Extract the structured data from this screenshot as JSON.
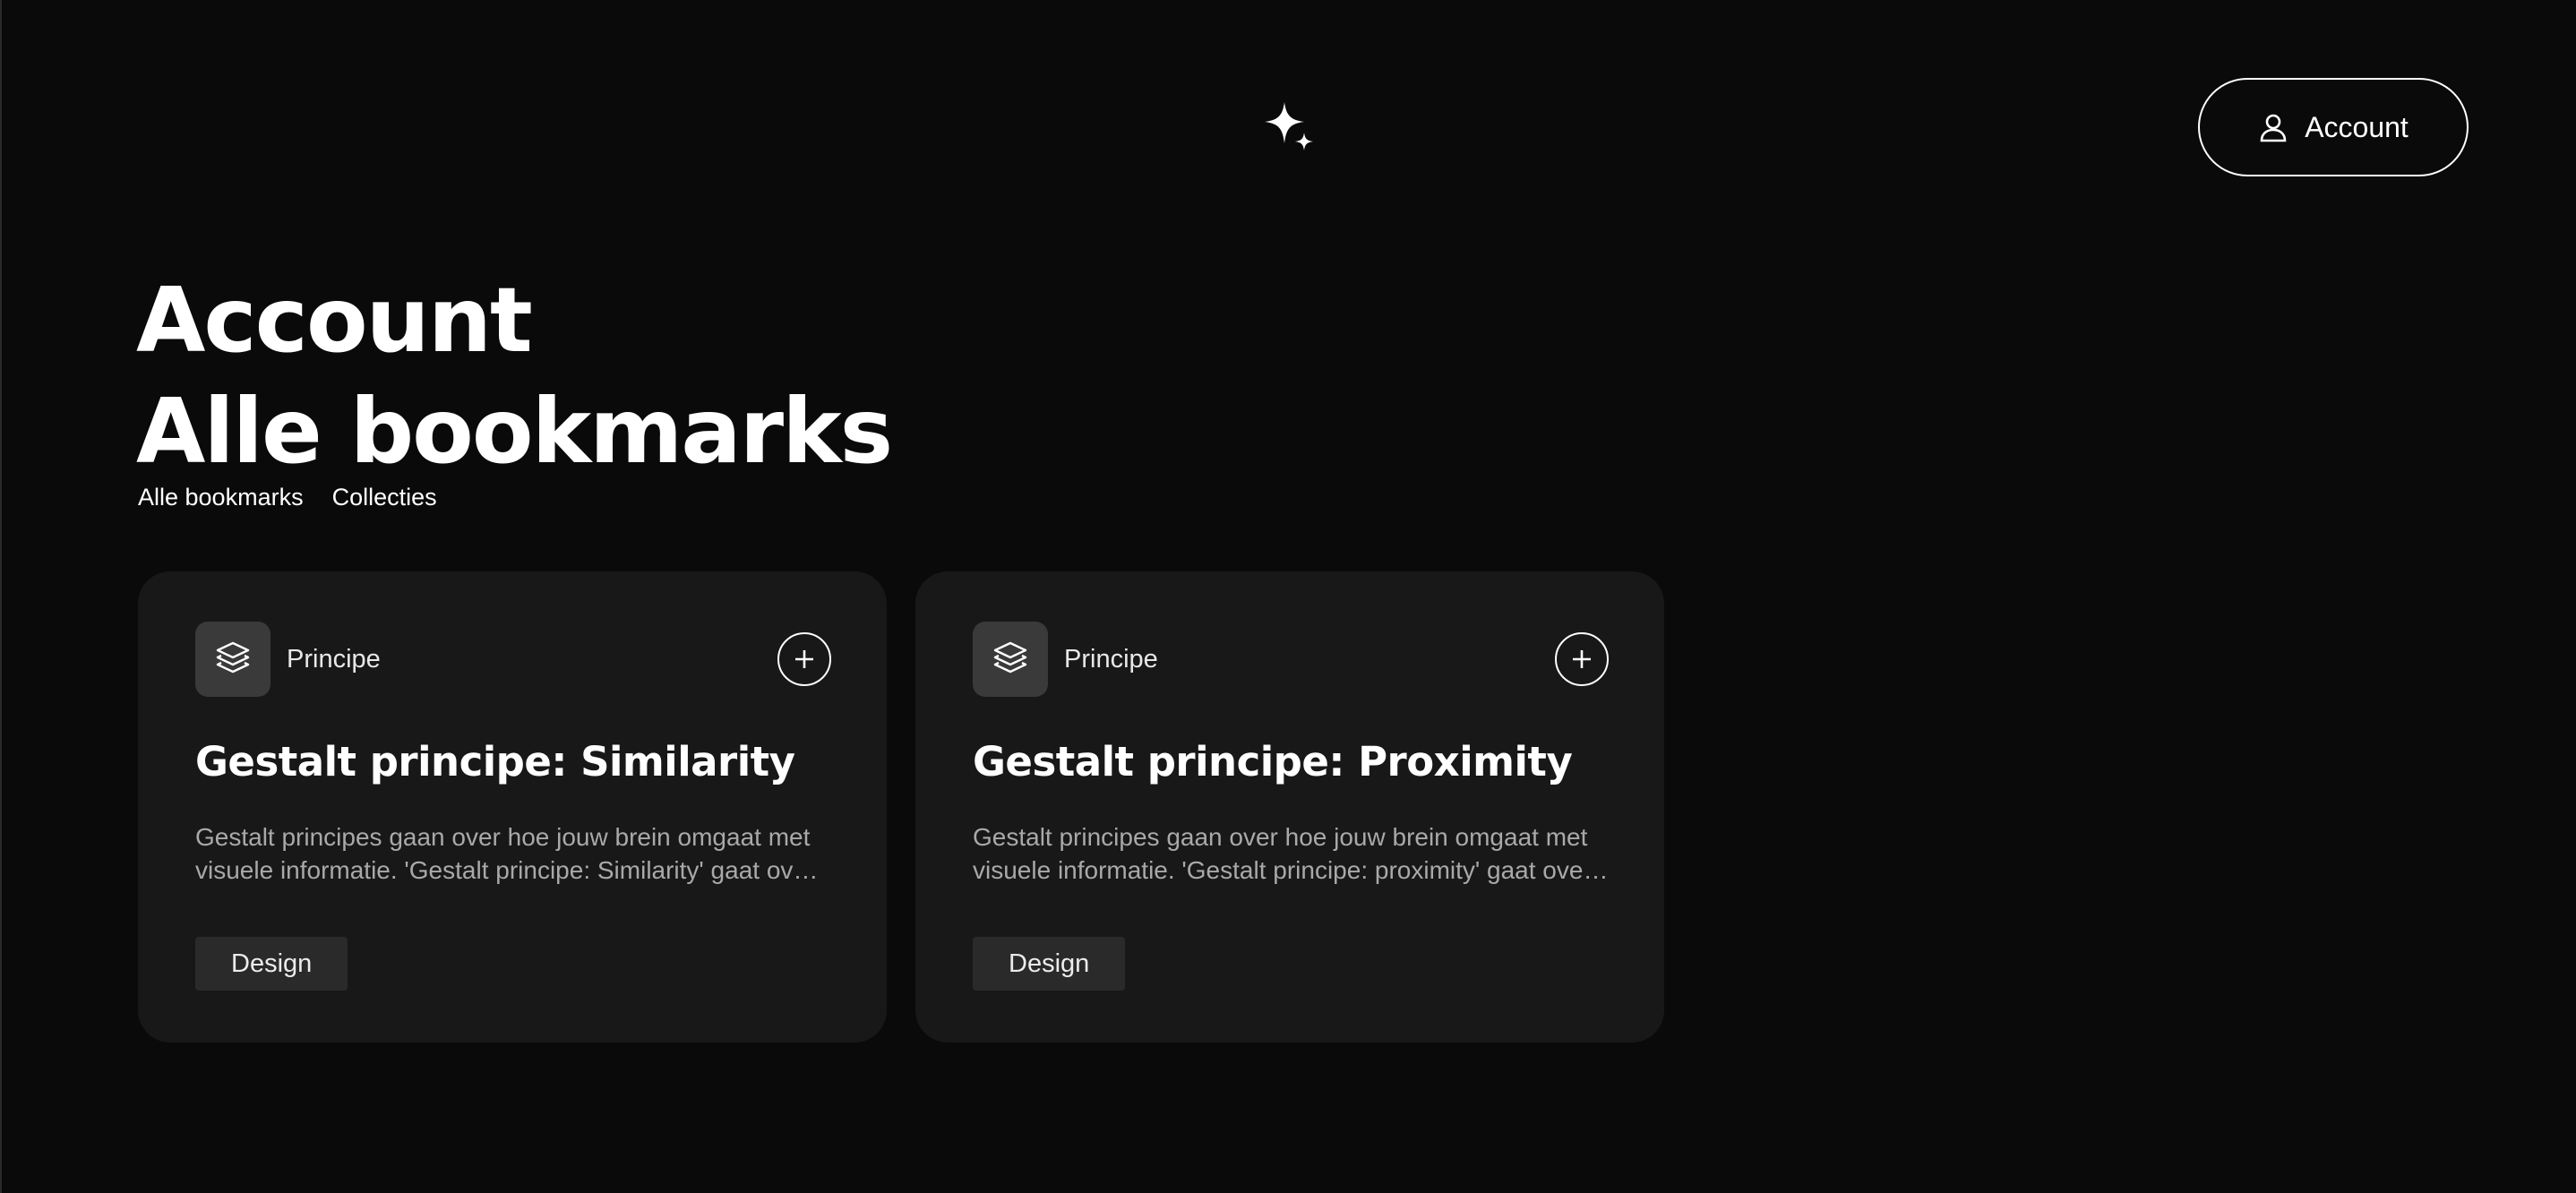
{
  "header": {
    "logo_icon": "sparkles-icon",
    "account_button": {
      "label": "Account",
      "icon": "user-icon"
    }
  },
  "page": {
    "title_line1": "Account",
    "title_line2": "Alle bookmarks"
  },
  "tabs": [
    {
      "label": "Alle bookmarks"
    },
    {
      "label": "Collecties"
    }
  ],
  "cards": [
    {
      "category": "Principe",
      "category_icon": "layers-icon",
      "add_icon": "plus-circle-icon",
      "title": "Gestalt principe: Similarity",
      "description": "Gestalt principes gaan over hoe jouw brein omgaat met visuele informatie. 'Gestalt principe: Similarity' gaat over hoe elementen die op elkaar lijken als groep worden gezien.",
      "tag": "Design"
    },
    {
      "category": "Principe",
      "category_icon": "layers-icon",
      "add_icon": "plus-circle-icon",
      "title": "Gestalt principe: Proximity",
      "description": "Gestalt principes gaan over hoe jouw brein omgaat met visuele informatie. 'Gestalt principe: proximity' gaat over hoe elementen die dicht bij elkaar staan als groep worden gezien.",
      "tag": "Design"
    }
  ],
  "colors": {
    "background": "#0a0a0a",
    "card_background": "#181818",
    "tag_background": "#2a2a2a",
    "text_primary": "#ffffff",
    "text_muted": "#a9a9a9"
  }
}
